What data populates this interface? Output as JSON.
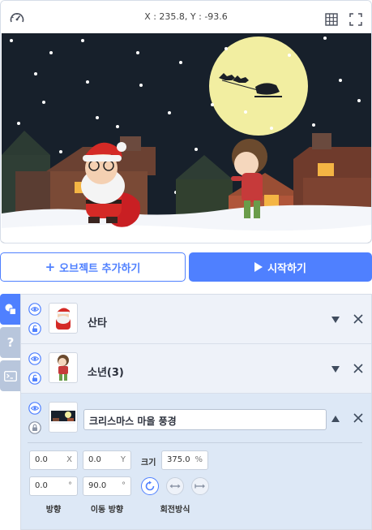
{
  "stage": {
    "coords": "X : 235.8, Y : -93.6",
    "icons": {
      "speed": "speedometer-icon",
      "grid": "grid-icon",
      "fullscreen": "fullscreen-icon"
    }
  },
  "buttons": {
    "add_object": "오브젝트 추가하기",
    "add_icon": "plus-icon",
    "start": "시작하기",
    "start_icon": "play-icon"
  },
  "side_tabs": [
    {
      "icon": "shapes-icon",
      "active": true
    },
    {
      "icon": "question-icon",
      "active": false
    },
    {
      "icon": "console-icon",
      "active": false
    }
  ],
  "objects": [
    {
      "name": "산타",
      "expanded": false
    },
    {
      "name": "소년(3)",
      "expanded": false
    },
    {
      "name": "크리스마스 마을 풍경",
      "expanded": true
    }
  ],
  "properties": {
    "x": "0.0",
    "x_unit": "X",
    "y": "0.0",
    "y_unit": "Y",
    "size_label": "크기",
    "size": "375.0",
    "size_unit": "%",
    "direction": "0.0",
    "direction_unit": "°",
    "move_direction": "90.0",
    "move_direction_unit": "°",
    "direction_label": "방향",
    "move_direction_label": "이동 방향",
    "rotation_label": "회전방식"
  },
  "colors": {
    "accent": "#4f80ff",
    "panel_bg": "#eef2f9",
    "side_tab": "#b8c6dc"
  }
}
